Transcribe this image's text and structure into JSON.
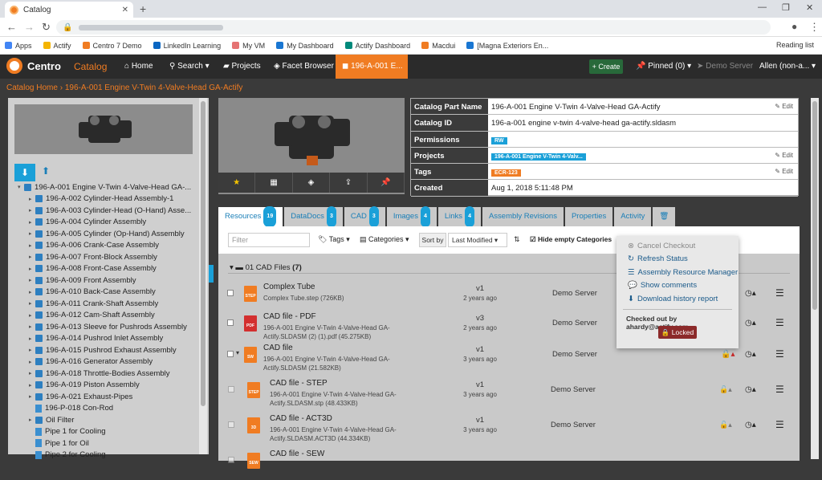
{
  "browser": {
    "tab_title": "Catalog",
    "new_tab": "+",
    "bookmarks": [
      {
        "label": "Apps",
        "color": "#4285f4"
      },
      {
        "label": "Actify",
        "color": "#f4b400"
      },
      {
        "label": "Centro 7 Demo",
        "color": "#f07c22"
      },
      {
        "label": "LinkedIn Learning",
        "color": "#0a66c2"
      },
      {
        "label": "My VM",
        "color": "#e57373"
      },
      {
        "label": "My Dashboard",
        "color": "#1976d2"
      },
      {
        "label": "Actify Dashboard",
        "color": "#00897b"
      },
      {
        "label": "Macdui",
        "color": "#f07c22"
      },
      {
        "label": "[Magna Exteriors En...",
        "color": "#1976d2"
      }
    ],
    "reading_list": "Reading list"
  },
  "appnav": {
    "brand": "Centro",
    "section": "Catalog",
    "home": "Home",
    "search": "Search",
    "projects": "Projects",
    "facet_browser": "Facet Browser",
    "active_tab": "196-A-001 E...",
    "create": "+ Create",
    "pinned": "Pinned (0)",
    "server": "Demo Server",
    "user": "Allen (non-a..."
  },
  "breadcrumb": {
    "root": "Catalog Home",
    "sep": "›",
    "current": "196-A-001 Engine V-Twin 4-Valve-Head GA-Actify"
  },
  "tree": {
    "items": [
      {
        "label": "196-A-001 Engine V-Twin 4-Valve-Head GA-...",
        "type": "folder",
        "toggle": "▾",
        "indent": 0
      },
      {
        "label": "196-A-002 Cylinder-Head Assembly-1",
        "type": "folder",
        "toggle": "▸",
        "indent": 1
      },
      {
        "label": "196-A-003 Cylinder-Head (O-Hand) Asse...",
        "type": "folder",
        "toggle": "▸",
        "indent": 1
      },
      {
        "label": "196-A-004 Cylinder Assembly",
        "type": "folder",
        "toggle": "▸",
        "indent": 1
      },
      {
        "label": "196-A-005 Cylinder (Op-Hand) Assembly",
        "type": "folder",
        "toggle": "▸",
        "indent": 1
      },
      {
        "label": "196-A-006 Crank-Case Assembly",
        "type": "folder",
        "toggle": "▸",
        "indent": 1
      },
      {
        "label": "196-A-007 Front-Block Assembly",
        "type": "folder",
        "toggle": "▸",
        "indent": 1
      },
      {
        "label": "196-A-008 Front-Case Assembly",
        "type": "folder",
        "toggle": "▸",
        "indent": 1
      },
      {
        "label": "196-A-009 Front Assembly",
        "type": "folder",
        "toggle": "▸",
        "indent": 1
      },
      {
        "label": "196-A-010 Back-Case Assembly",
        "type": "folder",
        "toggle": "▸",
        "indent": 1
      },
      {
        "label": "196-A-011 Crank-Shaft Assembly",
        "type": "folder",
        "toggle": "▸",
        "indent": 1
      },
      {
        "label": "196-A-012 Cam-Shaft Assembly",
        "type": "folder",
        "toggle": "▸",
        "indent": 1
      },
      {
        "label": "196-A-013 Sleeve for Pushrods Assembly",
        "type": "folder",
        "toggle": "▸",
        "indent": 1
      },
      {
        "label": "196-A-014 Pushrod Inlet Assembly",
        "type": "folder",
        "toggle": "▸",
        "indent": 1
      },
      {
        "label": "196-A-015 Pushrod Exhaust Assembly",
        "type": "folder",
        "toggle": "▸",
        "indent": 1
      },
      {
        "label": "196-A-016 Generator Assembly",
        "type": "folder",
        "toggle": "▸",
        "indent": 1
      },
      {
        "label": "196-A-018 Throttle-Bodies Assembly",
        "type": "folder",
        "toggle": "▸",
        "indent": 1
      },
      {
        "label": "196-A-019 Piston Assembly",
        "type": "folder",
        "toggle": "▸",
        "indent": 1
      },
      {
        "label": "196-A-021 Exhaust-Pipes",
        "type": "folder",
        "toggle": "▸",
        "indent": 1
      },
      {
        "label": "196-P-018 Con-Rod",
        "type": "part",
        "toggle": "",
        "indent": 1
      },
      {
        "label": "Oil Filter",
        "type": "folder",
        "toggle": "▸",
        "indent": 1
      },
      {
        "label": "Pipe 1 for Cooling",
        "type": "part",
        "toggle": "",
        "indent": 1
      },
      {
        "label": "Pipe 1 for Oil",
        "type": "part",
        "toggle": "",
        "indent": 1
      },
      {
        "label": "Pipe 2 for Cooling",
        "type": "part",
        "toggle": "",
        "indent": 1
      }
    ]
  },
  "meta": {
    "rows": [
      {
        "label": "Catalog Part Name",
        "value": "196-A-001 Engine V-Twin 4-Valve-Head GA-Actify",
        "edit": "Edit",
        "kind": "text"
      },
      {
        "label": "Catalog ID",
        "value": "196-a-001 engine v-twin 4-valve-head ga-actify.sldasm",
        "edit": "",
        "kind": "text"
      },
      {
        "label": "Permissions",
        "value": "RW",
        "edit": "",
        "kind": "rw"
      },
      {
        "label": "Projects",
        "value": "196-A-001 Engine V-Twin 4-Valv...",
        "edit": "Edit",
        "kind": "proj"
      },
      {
        "label": "Tags",
        "value": "ECR-123",
        "edit": "Edit",
        "kind": "ecr"
      },
      {
        "label": "Created",
        "value": "Aug 1, 2018 5:11:48 PM",
        "edit": "",
        "kind": "text"
      }
    ]
  },
  "tabs": [
    {
      "label": "Resources",
      "badge": "19",
      "active": true
    },
    {
      "label": "DataDocs",
      "badge": "3"
    },
    {
      "label": "CAD",
      "badge": "3"
    },
    {
      "label": "Images",
      "badge": "4"
    },
    {
      "label": "Links",
      "badge": "4"
    },
    {
      "label": "Assembly Revisions",
      "badge": ""
    },
    {
      "label": "Properties",
      "badge": ""
    },
    {
      "label": "Activity",
      "badge": ""
    },
    {
      "label": "🗑",
      "badge": ""
    }
  ],
  "toolbar": {
    "filter_placeholder": "Filter",
    "tags": "Tags",
    "categories": "Categories",
    "sort_by": "Sort by",
    "sort_value": "Last Modified",
    "hide_empty": "Hide empty Categories"
  },
  "group": {
    "title": "01 CAD Files",
    "count": "(7)"
  },
  "files": [
    {
      "name": "Complex Tube",
      "desc": "Complex Tube.step (726KB)",
      "ver": "v1",
      "ago": "2 years ago",
      "server": "Demo Server",
      "icon": "STEP",
      "color": "#f07c22"
    },
    {
      "name": "CAD file - PDF",
      "desc": "196-A-001 Engine V-Twin 4-Valve-Head GA-Actify.SLDASM (2) (1).pdf (45.275KB)",
      "ver": "v3",
      "ago": "2 years ago",
      "server": "Demo Server",
      "icon": "PDF",
      "color": "#d32f2f"
    },
    {
      "name": "CAD file",
      "desc": "196-A-001 Engine V-Twin 4-Valve-Head GA-Actify.SLDASM (21.582KB)",
      "ver": "v1",
      "ago": "3 years ago",
      "server": "Demo Server",
      "icon": "SW",
      "color": "#f07c22"
    },
    {
      "name": "CAD file - STEP",
      "desc": "196-A-001 Engine V-Twin 4-Valve-Head GA-Actify.SLDASM.stp (48.433KB)",
      "ver": "v1",
      "ago": "3 years ago",
      "server": "Demo Server",
      "icon": "STEP",
      "color": "#f07c22"
    },
    {
      "name": "CAD file - ACT3D",
      "desc": "196-A-001 Engine V-Twin 4-Valve-Head GA-Actify.SLDASM.ACT3D (44.334KB)",
      "ver": "v1",
      "ago": "3 years ago",
      "server": "Demo Server",
      "icon": "3D",
      "color": "#f07c22"
    },
    {
      "name": "CAD file - SEW",
      "desc": "",
      "ver": "",
      "ago": "",
      "server": "",
      "icon": "SEW",
      "color": "#f07c22"
    }
  ],
  "dropdown": {
    "items": [
      "Cancel Checkout",
      "Refresh Status",
      "Assembly Resource Manager",
      "Show comments",
      "Download history report"
    ],
    "checked_out": "Checked out by ahardy@actify.com",
    "locked": "Locked"
  }
}
